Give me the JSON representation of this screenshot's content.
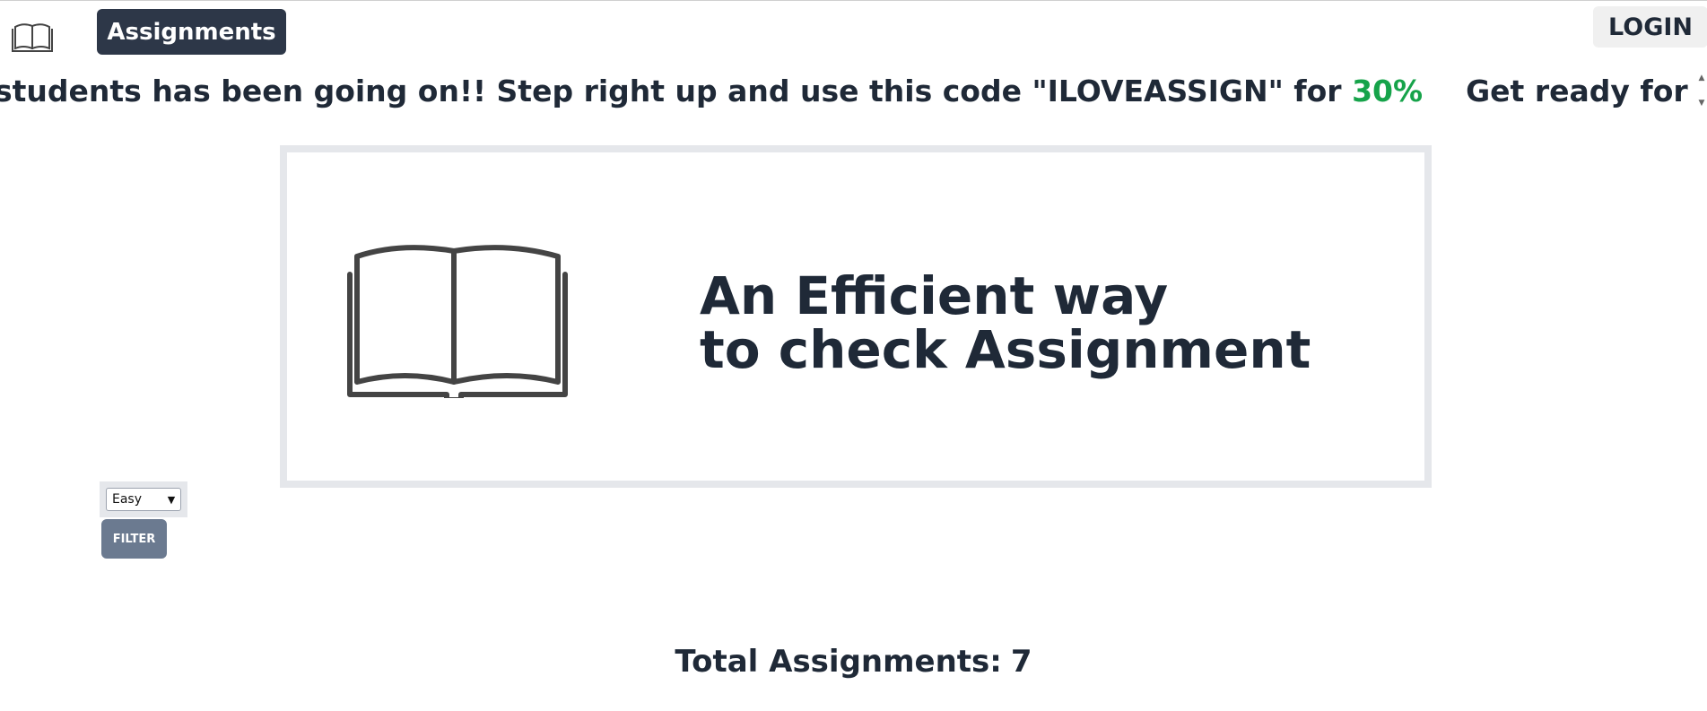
{
  "header": {
    "logo_icon": "open-book-icon",
    "nav_label": "Assignments",
    "login_label": "LOGIN"
  },
  "marquee": {
    "text_main": "students has been going on!! Step right up and use this code \"ILOVEASSIGN\" for",
    "discount": "30%",
    "text_next": "Get ready for some fant"
  },
  "hero": {
    "icon": "open-book-icon",
    "title_line1": "An Efficient way",
    "title_line2": "to check Assignment"
  },
  "filter": {
    "selected": "Easy",
    "button_label": "FILTER"
  },
  "summary": {
    "label": "Total Assignments:",
    "count": "7"
  },
  "colors": {
    "nav_bg": "#2d3748",
    "accent_green": "#16a34a",
    "filter_btn_bg": "#6b7a90",
    "hero_border": "#e5e7eb"
  }
}
